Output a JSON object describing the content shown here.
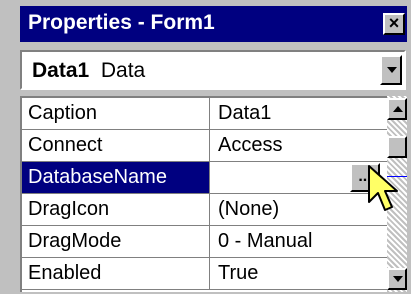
{
  "window": {
    "title": "Properties - Form1",
    "close_glyph": "×"
  },
  "object_selector": {
    "name": "Data1",
    "type": "Data"
  },
  "properties": [
    {
      "name": "Caption",
      "value": "Data1"
    },
    {
      "name": "Connect",
      "value": "Access"
    },
    {
      "name": "DatabaseName",
      "value": ""
    },
    {
      "name": "DragIcon",
      "value": "(None)"
    },
    {
      "name": "DragMode",
      "value": "0 - Manual"
    },
    {
      "name": "Enabled",
      "value": "True"
    }
  ],
  "selected_property": "DatabaseName",
  "ellipsis_label": "...",
  "colors": {
    "title_bar": "#000080",
    "selection": "#000080",
    "face": "#c0c0c0",
    "cursor": "#ffff66"
  },
  "icons": [
    "close-icon",
    "dropdown-arrow-icon",
    "scroll-up-icon",
    "scroll-down-icon",
    "arrow-cursor-icon"
  ]
}
